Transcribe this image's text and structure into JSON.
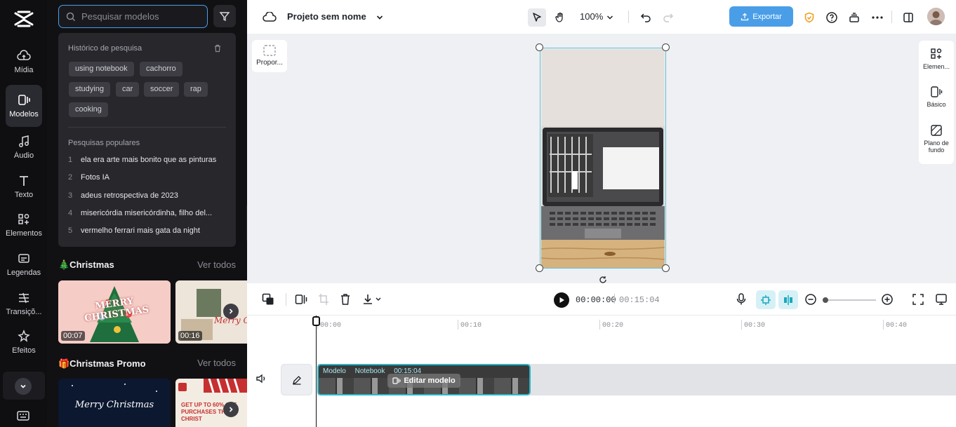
{
  "rail": {
    "items": [
      {
        "label": "Mídia",
        "icon": "cloud-upload-icon"
      },
      {
        "label": "Modelos",
        "icon": "templates-icon",
        "active": true
      },
      {
        "label": "Áudio",
        "icon": "music-note-icon"
      },
      {
        "label": "Texto",
        "icon": "text-icon"
      },
      {
        "label": "Elementos",
        "icon": "elements-icon"
      },
      {
        "label": "Legendas",
        "icon": "captions-icon"
      },
      {
        "label": "Transiçõ...",
        "icon": "transitions-icon"
      },
      {
        "label": "Efeitos",
        "icon": "effects-icon"
      }
    ]
  },
  "panel": {
    "search_placeholder": "Pesquisar modelos",
    "history_title": "Histórico de pesquisa",
    "history": [
      "using notebook",
      "cachorro",
      "studying",
      "car",
      "soccer",
      "rap",
      "cooking"
    ],
    "popular_title": "Pesquisas populares",
    "popular": [
      {
        "n": "1",
        "text": "ela era arte mais bonito que as pinturas"
      },
      {
        "n": "2",
        "text": "Fotos IA"
      },
      {
        "n": "3",
        "text": "adeus retrospectiva de 2023"
      },
      {
        "n": "4",
        "text": "misericórdia misericórdinha, filho del..."
      },
      {
        "n": "5",
        "text": "vermelho ferrari mais gata da night"
      }
    ],
    "sections": [
      {
        "title": "🎄Christmas",
        "see_all": "Ver todos",
        "durations": [
          "00:07",
          "00:16"
        ]
      },
      {
        "title": "🎁Christmas Promo",
        "see_all": "Ver todos"
      }
    ],
    "thumb_texts": {
      "merry": "MERRY CHRISTMAS",
      "merry_script": "Merry Christmas",
      "promo": "GET UP TO 60% OFF PURCHASES THIS CHRIST"
    }
  },
  "topbar": {
    "project_title": "Projeto sem nome",
    "zoom": "100%",
    "export_label": "Exportar"
  },
  "canvas": {
    "ratio_label": "Propor...",
    "right_tools": [
      {
        "label": "Elemen...",
        "icon": "elements-icon"
      },
      {
        "label": "Básico",
        "icon": "basic-icon"
      },
      {
        "label": "Plano de fundo",
        "icon": "background-icon"
      }
    ]
  },
  "playback": {
    "current": "00:00:00",
    "total": "00:15:04"
  },
  "timeline": {
    "ticks": [
      "00:00",
      "00:10",
      "00:20",
      "00:30",
      "00:40"
    ],
    "clip": {
      "tag": "Modelo",
      "name": "Notebook",
      "duration": "00:15:04",
      "edit_label": "Editar modelo"
    }
  },
  "colors": {
    "accent": "#4a9ee8",
    "selection": "#57c5d6",
    "rail_bg": "#0f0f12",
    "panel_bg": "#111114"
  }
}
